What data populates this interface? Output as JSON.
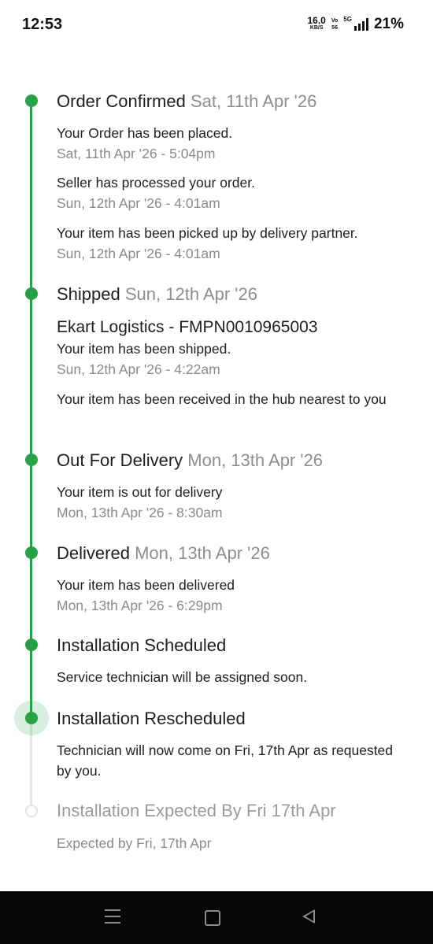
{
  "status_bar": {
    "time": "12:53",
    "net_speed_value": "16.0",
    "net_speed_unit": "KB/S",
    "volte_top": "Vo",
    "volte_bottom": "56",
    "network": "5G",
    "battery": "21%"
  },
  "steps": [
    {
      "title": "Order Confirmed",
      "date": "Sat, 11th Apr '26",
      "events": [
        {
          "text": "Your Order has been placed.",
          "time": "Sat, 11th Apr '26 - 5:04pm"
        },
        {
          "text": "Seller has processed your order.",
          "time": "Sun, 12th Apr '26 - 4:01am"
        },
        {
          "text": "Your item has been picked up by delivery partner.",
          "time": "Sun, 12th Apr '26 - 4:01am"
        }
      ]
    },
    {
      "title": "Shipped",
      "date": "Sun, 12th Apr '26",
      "courier": "Ekart Logistics - FMPN0010965003",
      "events": [
        {
          "text": "Your item has been shipped.",
          "time": "Sun, 12th Apr '26 - 4:22am"
        },
        {
          "text": "Your item has been received in the hub nearest to you"
        }
      ]
    },
    {
      "title": "Out For Delivery",
      "date": "Mon, 13th Apr '26",
      "events": [
        {
          "text": "Your item is out for delivery",
          "time": "Mon, 13th Apr '26 - 8:30am"
        }
      ]
    },
    {
      "title": "Delivered",
      "date": "Mon, 13th Apr '26",
      "events": [
        {
          "text": "Your item has been delivered",
          "time": "Mon, 13th Apr '26 - 6:29pm"
        }
      ]
    },
    {
      "title": "Installation Scheduled",
      "events": [
        {
          "text": "Service technician will be assigned soon."
        }
      ]
    },
    {
      "title": "Installation Rescheduled",
      "events": [
        {
          "text": "Technician will now come on Fri, 17th Apr as requested by you."
        }
      ]
    },
    {
      "title": "Installation Expected By Fri 17th Apr",
      "events": [
        {
          "time": "Expected by Fri, 17th Apr"
        }
      ]
    }
  ],
  "colors": {
    "accent": "#27a046",
    "pending_line": "#e6e6e6",
    "muted_text": "#8a8a8a",
    "nav_bar": "#060606"
  },
  "nav_bar": {
    "icons": [
      "menu-icon",
      "home-icon",
      "back-icon"
    ]
  }
}
